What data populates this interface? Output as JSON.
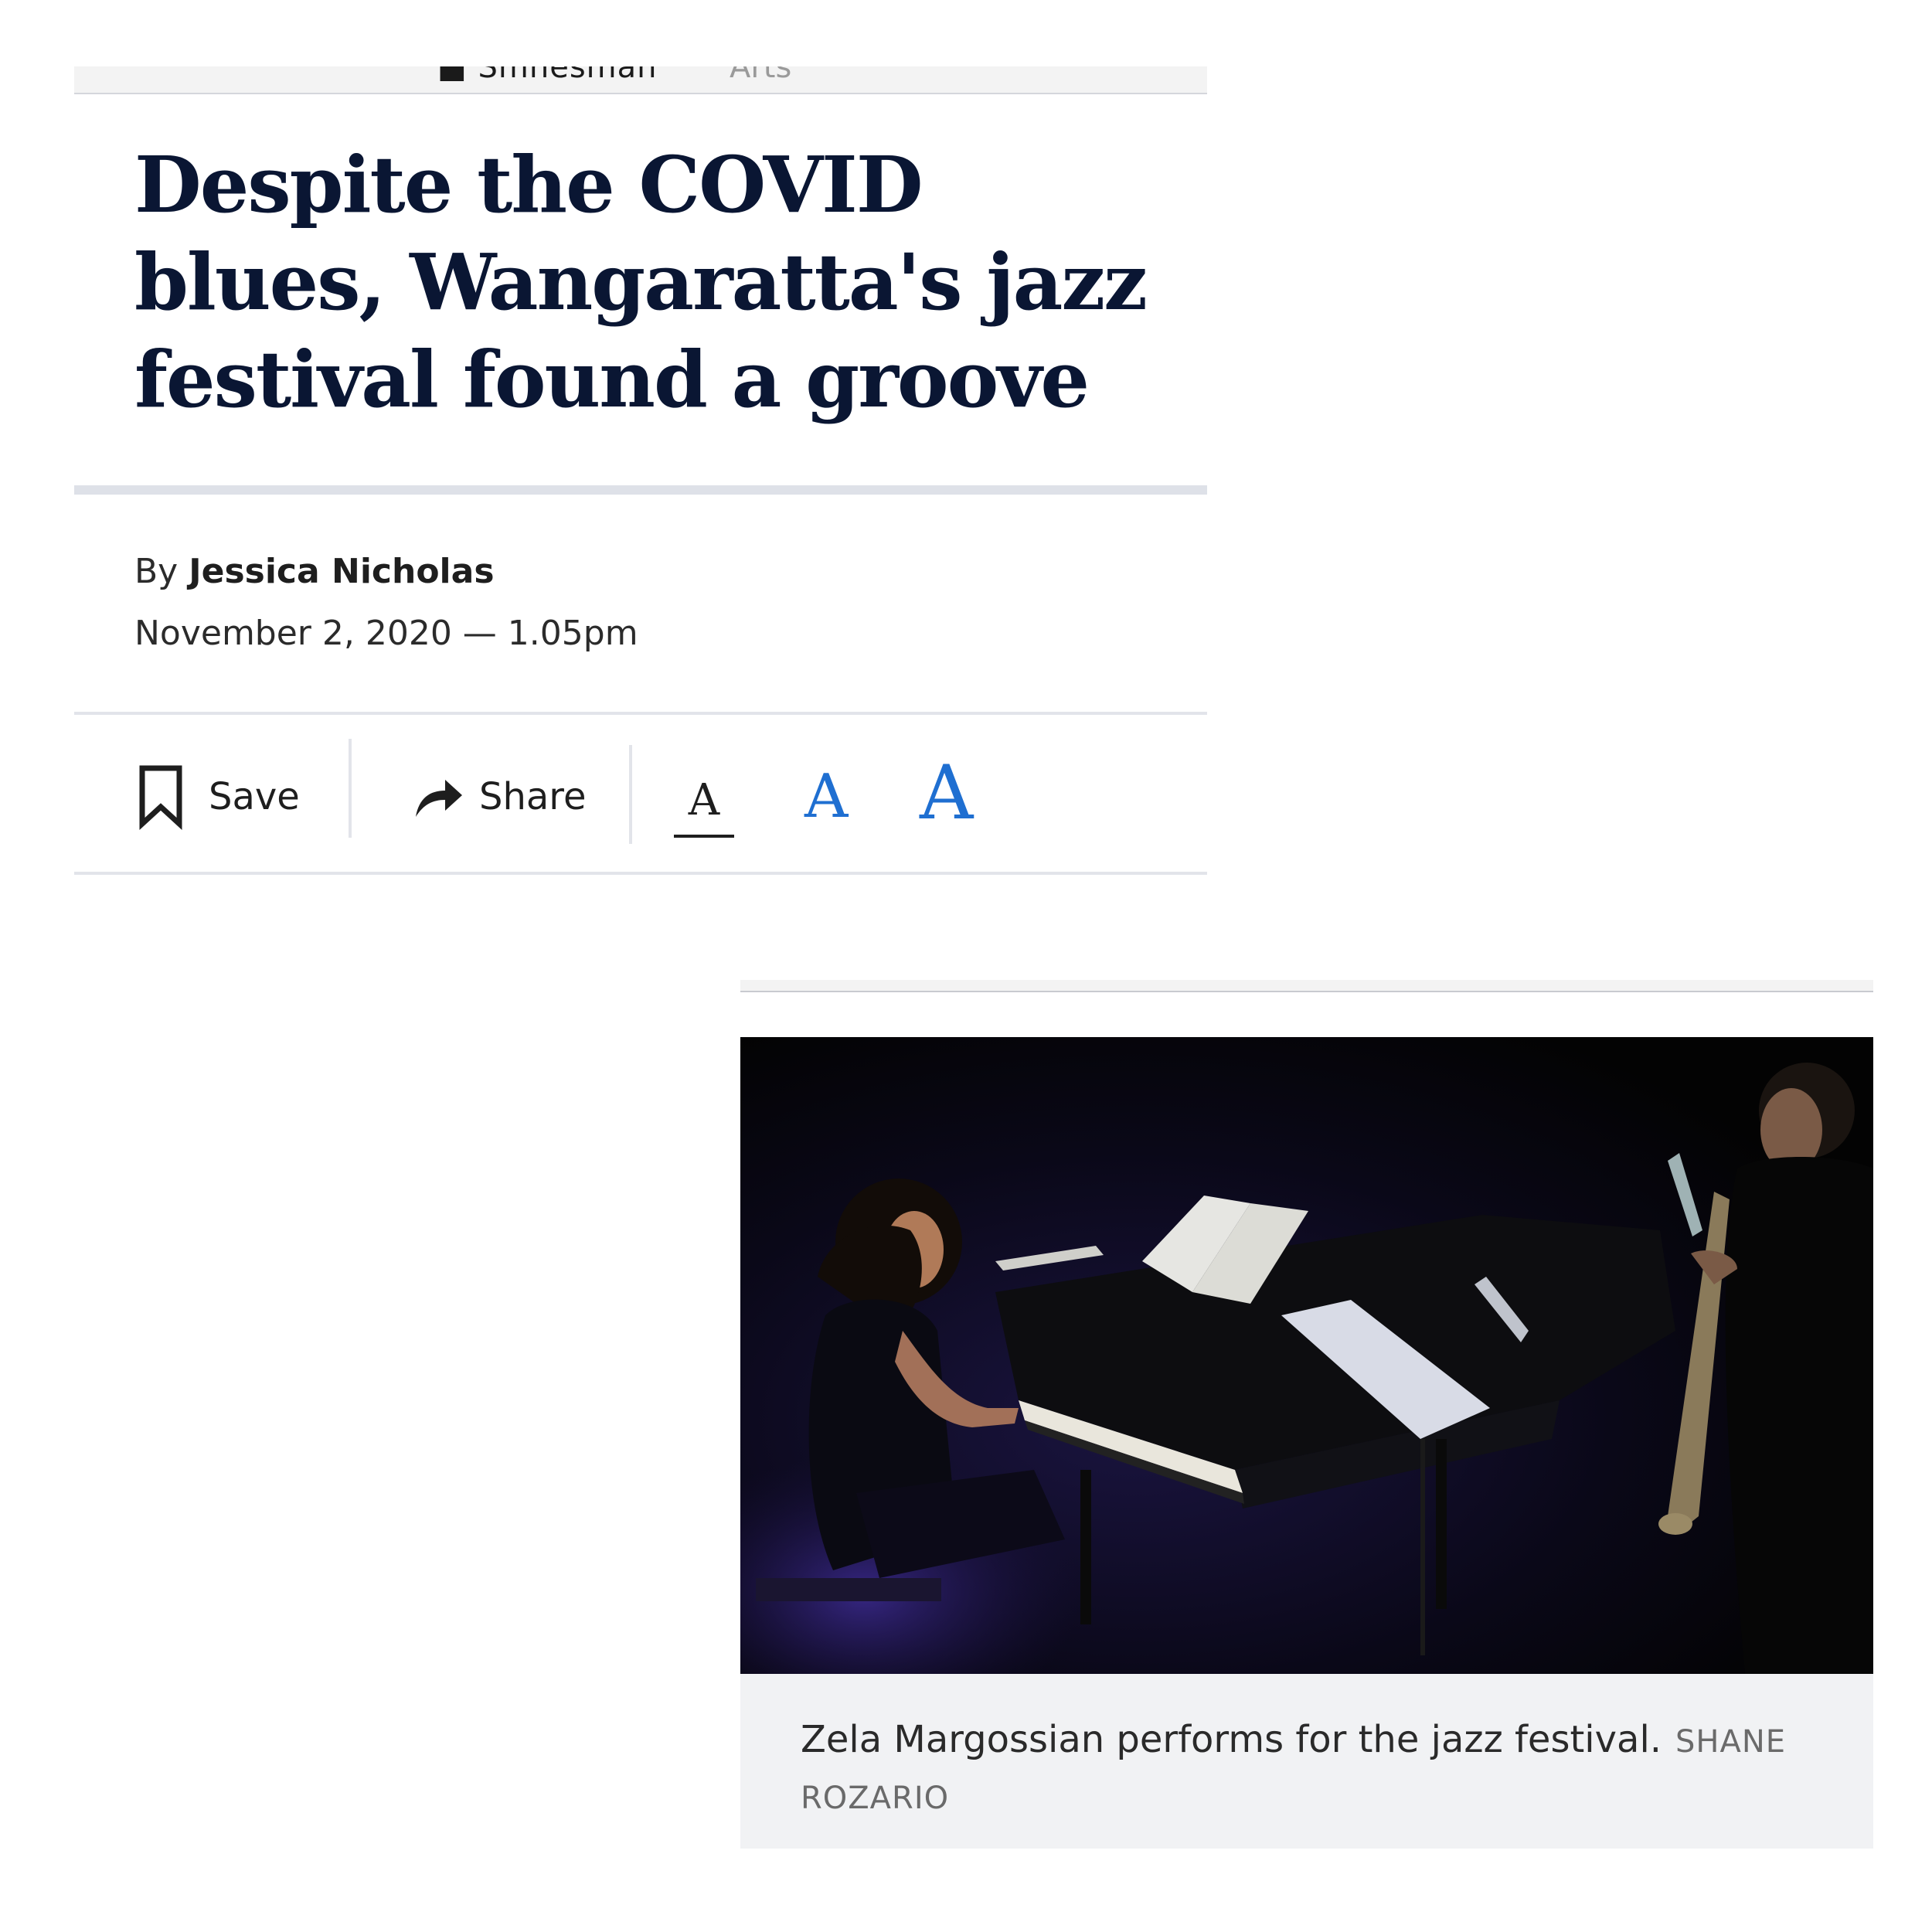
{
  "top_strip": {
    "left_text": "■ Smnesman",
    "right_text": "Arts"
  },
  "article": {
    "headline": "Despite the COVID blues, Wangaratta's jazz festival found a groove",
    "byline_prefix": "By",
    "author": "Jessica Nicholas",
    "date": "November 2, 2020 — 1.05pm"
  },
  "toolbar": {
    "save_label": "Save",
    "share_label": "Share",
    "font_small": "A",
    "font_medium": "A",
    "font_large": "A",
    "selected_size": "small"
  },
  "photo": {
    "caption": "Zela Margossian performs for the jazz festival.",
    "credit": "SHANE ROZARIO"
  },
  "colors": {
    "headline": "#0a1633",
    "accent_blue": "#1f6fd1",
    "divider": "#e2e4ea",
    "caption_bg": "#f1f2f4"
  }
}
